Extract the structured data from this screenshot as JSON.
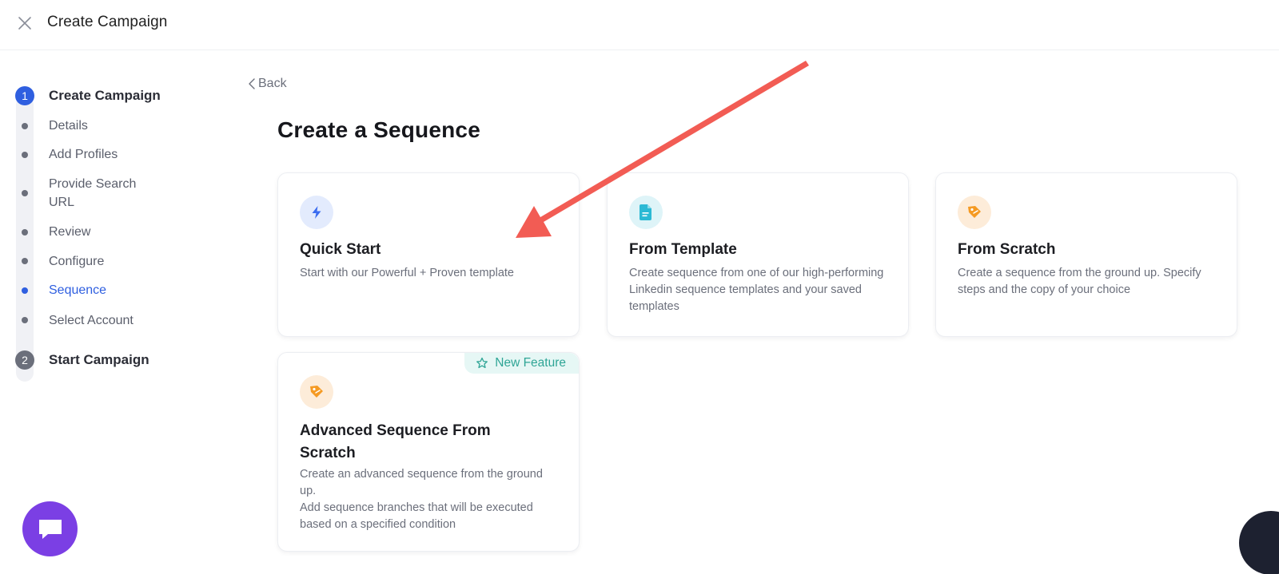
{
  "header": {
    "title": "Create Campaign"
  },
  "stepper": {
    "steps": [
      {
        "number": "1",
        "label": "Create Campaign"
      },
      {
        "number": "2",
        "label": "Start Campaign"
      }
    ],
    "sub_items": [
      "Details",
      "Add Profiles",
      "Provide Search URL",
      "Review",
      "Configure",
      "Sequence",
      "Select Account"
    ],
    "current_sub_item": "Sequence"
  },
  "back_label": "Back",
  "page_title": "Create a Sequence",
  "cards": [
    {
      "title": "Quick Start",
      "description": "Start with our Powerful + Proven template",
      "icon": "bolt-icon"
    },
    {
      "title": "From Template",
      "description": "Create sequence from one of our high-performing Linkedin sequence templates and your saved templates",
      "icon": "document-icon"
    },
    {
      "title": "From Scratch",
      "description": "Create a sequence from the ground up. Specify steps and the copy of your choice",
      "icon": "pen-tag-icon"
    },
    {
      "title": "Advanced Sequence From Scratch",
      "description_line1": "Create an advanced sequence from the ground up.",
      "description_line2": "Add sequence branches that will be executed based on a specified condition",
      "icon": "pen-tag-icon",
      "badge": "New Feature"
    }
  ],
  "colors": {
    "accent": "#2f5fe0",
    "badge_text": "#2fa596",
    "badge_bg": "#e6f7f5",
    "chat": "#7b3fe4",
    "annotation_arrow": "#f25c54"
  }
}
